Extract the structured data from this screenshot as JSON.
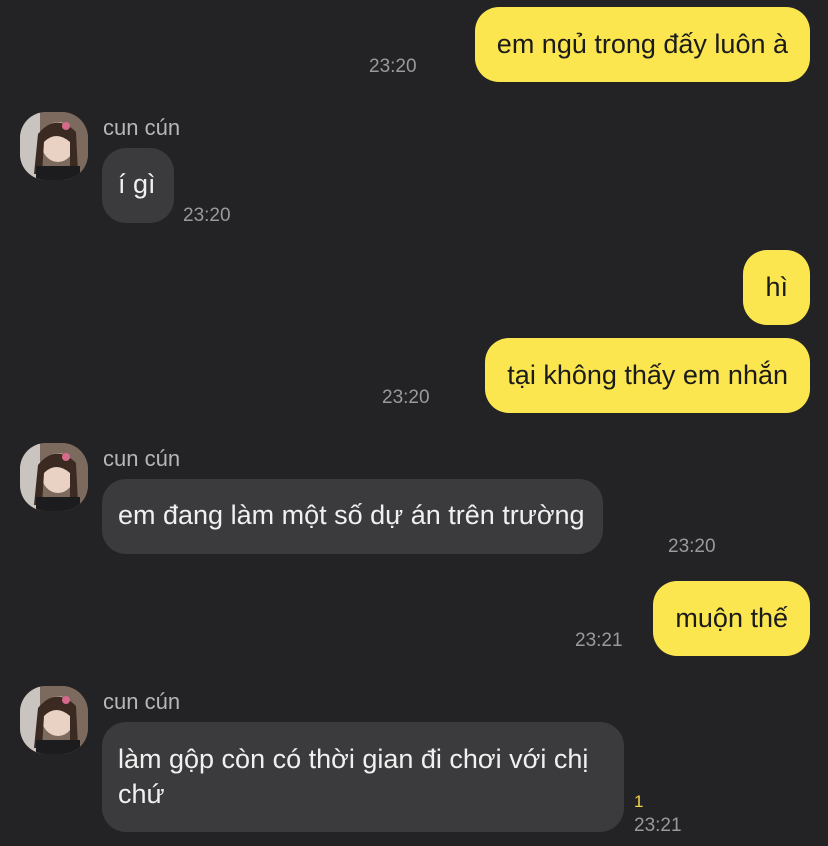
{
  "messages": [
    {
      "text": "em ngủ trong đấy luôn à",
      "time": "23:20"
    },
    {
      "sender": "cun cún",
      "text": "í gì",
      "time": "23:20"
    },
    {
      "text": "hì"
    },
    {
      "text": "tại không thấy em nhắn",
      "time": "23:20"
    },
    {
      "sender": "cun cún",
      "text": "em đang làm một số dự án trên trường",
      "time": "23:20"
    },
    {
      "text": "muộn thế",
      "time": "23:21"
    },
    {
      "sender": "cun cún",
      "text": "làm gộp còn có thời gian đi chơi với chị chứ",
      "time": "23:21",
      "unread_count": "1"
    }
  ],
  "colors": {
    "background": "#232325",
    "outgoing_bubble": "#fbe650",
    "incoming_bubble": "#3b3b3d",
    "unread": "#f2d24b"
  },
  "icons": {
    "avatar": "profile-photo"
  }
}
